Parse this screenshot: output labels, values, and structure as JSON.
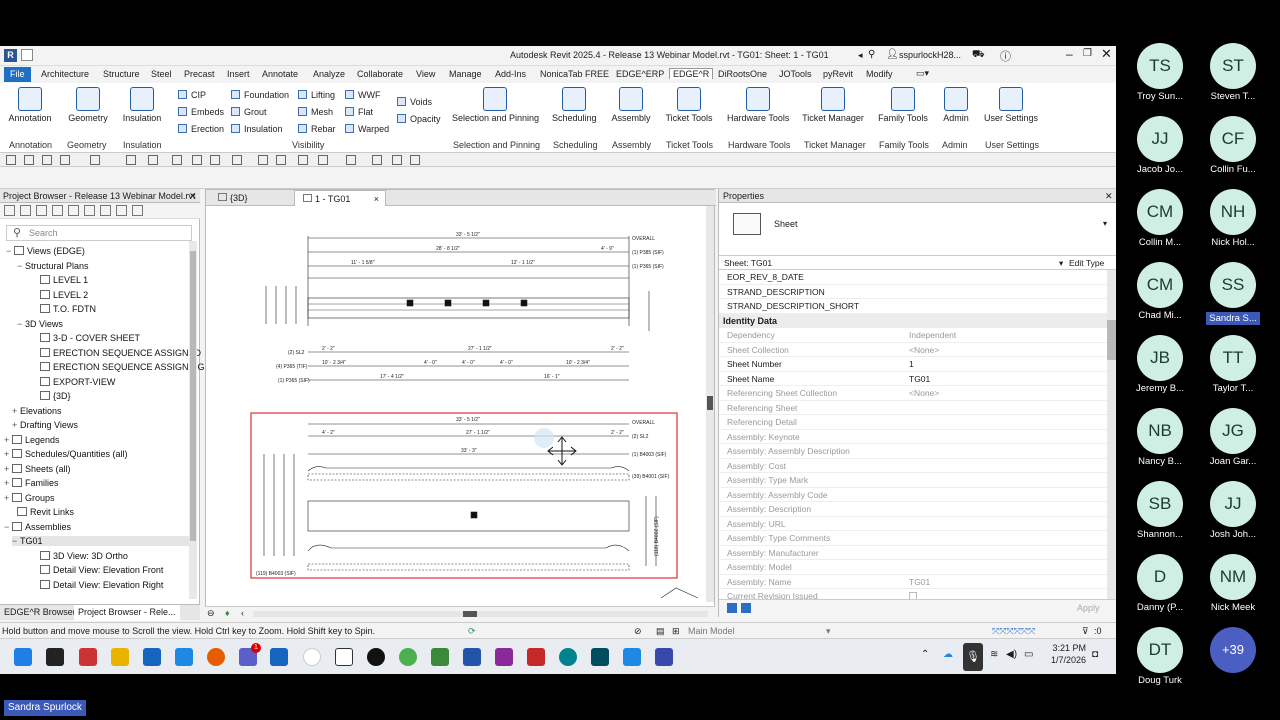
{
  "window": {
    "title": "Autodesk Revit 2025.4 - Release 13 Webinar Model.rvt - TG01: Sheet: 1 - TG01",
    "user": "sspurlockH28..."
  },
  "ribbon_tabs": [
    "File",
    "Architecture",
    "Structure",
    "Steel",
    "Precast",
    "Insert",
    "Annotate",
    "Analyze",
    "Collaborate",
    "View",
    "Manage",
    "Add-Ins",
    "NonicaTab FREE",
    "EDGE^ERP",
    "EDGE^R",
    "DiRootsOne",
    "JOTools",
    "pyRevit",
    "Modify"
  ],
  "ribbon": {
    "annotation": "Annotation",
    "geometry": "Geometry",
    "insulation": "Insulation",
    "cip": "CIP",
    "embeds": "Embeds",
    "erection": "Erection",
    "foundation": "Foundation",
    "grout": "Grout",
    "insulation_small": "Insulation",
    "lifting": "Lifting",
    "mesh": "Mesh",
    "rebar": "Rebar",
    "wwf": "WWF",
    "flat": "Flat",
    "warped": "Warped",
    "voids": "Voids",
    "opacity": "Opacity",
    "selection_pinning": "Selection and Pinning",
    "scheduling": "Scheduling",
    "assembly": "Assembly",
    "ticket_tools": "Ticket Tools",
    "hardware_tools": "Hardware Tools",
    "ticket_manager": "Ticket Manager",
    "family_tools": "Family Tools",
    "admin": "Admin",
    "user_settings": "User Settings",
    "panels": {
      "annotation": "Annotation",
      "geometry": "Geometry",
      "insulation": "Insulation",
      "visibility": "Visibility",
      "selection_pinning": "Selection and Pinning",
      "scheduling": "Scheduling",
      "assembly": "Assembly",
      "ticket_tools": "Ticket Tools",
      "hardware_tools": "Hardware Tools",
      "ticket_manager": "Ticket Manager",
      "family_tools": "Family Tools",
      "admin": "Admin",
      "user_settings": "User Settings"
    }
  },
  "project_browser": {
    "title": "Project Browser - Release 13 Webinar Model.rvt",
    "search_placeholder": "Search",
    "items": [
      {
        "label": "Views (EDGE)",
        "toggle": "−"
      },
      {
        "label": "Structural Plans",
        "toggle": "−"
      },
      {
        "label": "LEVEL 1",
        "toggle": ""
      },
      {
        "label": "LEVEL 2",
        "toggle": ""
      },
      {
        "label": "T.O. FDTN",
        "toggle": ""
      },
      {
        "label": "3D Views",
        "toggle": "−"
      },
      {
        "label": "3-D - COVER SHEET",
        "toggle": ""
      },
      {
        "label": "ERECTION SEQUENCE ASSIGNED",
        "toggle": ""
      },
      {
        "label": "ERECTION SEQUENCE ASSIGNING",
        "toggle": ""
      },
      {
        "label": "EXPORT-VIEW",
        "toggle": ""
      },
      {
        "label": "{3D}",
        "toggle": ""
      },
      {
        "label": "Elevations",
        "toggle": "+"
      },
      {
        "label": "Drafting Views",
        "toggle": "+"
      },
      {
        "label": "Legends",
        "toggle": "+"
      },
      {
        "label": "Schedules/Quantities (all)",
        "toggle": "+"
      },
      {
        "label": "Sheets (all)",
        "toggle": "+"
      },
      {
        "label": "Families",
        "toggle": "+"
      },
      {
        "label": "Groups",
        "toggle": "+"
      },
      {
        "label": "Revit Links",
        "toggle": ""
      },
      {
        "label": "Assemblies",
        "toggle": "−"
      },
      {
        "label": "TG01",
        "toggle": "−"
      },
      {
        "label": "3D View: 3D Ortho",
        "toggle": ""
      },
      {
        "label": "Detail View: Elevation Front",
        "toggle": ""
      },
      {
        "label": "Detail View: Elevation Right",
        "toggle": ""
      }
    ],
    "bottom_tabs": [
      "EDGE^R Browser",
      "Project Browser - Rele..."
    ]
  },
  "view_tabs": [
    {
      "label": "{3D}"
    },
    {
      "label": "1 - TG01",
      "close": "×"
    }
  ],
  "properties": {
    "title": "Properties",
    "type": "Sheet",
    "selector": "Sheet: TG01",
    "edit_type": "Edit Type",
    "top_rows": [
      "EOR_REV_8_DATE",
      "STRAND_DESCRIPTION",
      "STRAND_DESCRIPTION_SHORT"
    ],
    "group": "Identity Data",
    "rows": [
      {
        "name": "Dependency",
        "value": "Independent",
        "greyed": true
      },
      {
        "name": "Sheet Collection",
        "value": "<None>",
        "greyed": true
      },
      {
        "name": "Sheet Number",
        "value": "1",
        "greyed": false
      },
      {
        "name": "Sheet Name",
        "value": "TG01",
        "greyed": false
      },
      {
        "name": "Referencing Sheet Collection",
        "value": "<None>",
        "greyed": true
      },
      {
        "name": "Referencing Sheet",
        "value": "",
        "greyed": true
      },
      {
        "name": "Referencing Detail",
        "value": "",
        "greyed": true
      },
      {
        "name": "Assembly: Keynote",
        "value": "",
        "greyed": true
      },
      {
        "name": "Assembly: Assembly Description",
        "value": "",
        "greyed": true
      },
      {
        "name": "Assembly: Cost",
        "value": "",
        "greyed": true
      },
      {
        "name": "Assembly: Type Mark",
        "value": "",
        "greyed": true
      },
      {
        "name": "Assembly: Assembly Code",
        "value": "",
        "greyed": true
      },
      {
        "name": "Assembly: Description",
        "value": "",
        "greyed": true
      },
      {
        "name": "Assembly: URL",
        "value": "",
        "greyed": true
      },
      {
        "name": "Assembly: Type Comments",
        "value": "",
        "greyed": true
      },
      {
        "name": "Assembly: Manufacturer",
        "value": "",
        "greyed": true
      },
      {
        "name": "Assembly: Model",
        "value": "",
        "greyed": true
      },
      {
        "name": "Assembly: Name",
        "value": "TG01",
        "greyed": true
      },
      {
        "name": "Current Revision Issued",
        "value": "",
        "greyed": true
      }
    ],
    "apply": "Apply"
  },
  "status": {
    "hint": "Hold button and move mouse to Scroll the view. Hold Ctrl key to Zoom. Hold Shift key to Spin.",
    "model": "Main Model",
    "filter_count": ":0"
  },
  "taskbar": {
    "time": "3:21 PM",
    "date": "1/7/2026",
    "badge": "1"
  },
  "drawing": {
    "top": {
      "overall": "33' - 5 1/2\"",
      "d1": "28' - 8 1/2\"",
      "d2": "4' - 9\"",
      "d3": "11' - 1 5/8\"",
      "d4": "12' - 1 1/2\"",
      "lbl_overall": "OVERALL",
      "lbl_p385": "(1) P385 (SIF)",
      "lbl_p365": "(1) P365 (SIF)",
      "b1": "2' - 2\"",
      "b2": "27' - 1 1/2\"",
      "b3": "2' - 2\"",
      "c1": "10' - 2 3/4\"",
      "c2": "4' - 0\"",
      "c3": "4' - 0\"",
      "c4": "4' - 0\"",
      "c5": "10' - 2 3/4\"",
      "e1": "17' - 4 1/2\"",
      "e2": "16' - 1\"",
      "lbl_sl2": "(2) SL2",
      "lbl_p365b": "(4) P365 (TIF)",
      "lbl_p385b": "(1) P365 (SIF)"
    },
    "bottom": {
      "overall": "33' - 5 1/2\"",
      "d1": "4' - 2\"",
      "d2": "27' - 1 1/2\"",
      "d3": "2' - 2\"",
      "d4": "33' - 3\"",
      "lbl_overall": "OVERALL",
      "lbl_sl2": "(2) SL2",
      "lbl_b4003": "(1) B4003 (SIF)",
      "lbl_b4001": "(39) B4001 (SIF)",
      "lbl_b4002": "(118) B4002 (SIF)",
      "lbl_bottom": "(119) B4003 (SIF)"
    }
  },
  "participants": [
    {
      "initials": "TS",
      "name": "Troy Sun...",
      "highlight": false
    },
    {
      "initials": "ST",
      "name": "Steven T...",
      "highlight": false
    },
    {
      "initials": "JJ",
      "name": "Jacob Jo...",
      "highlight": false
    },
    {
      "initials": "CF",
      "name": "Collin Fu...",
      "highlight": false
    },
    {
      "initials": "CM",
      "name": "Collin M...",
      "highlight": false
    },
    {
      "initials": "NH",
      "name": "Nick Hol...",
      "highlight": false
    },
    {
      "initials": "CM",
      "name": "Chad Mi...",
      "highlight": false
    },
    {
      "initials": "SS",
      "name": "Sandra S...",
      "highlight": true
    },
    {
      "initials": "JB",
      "name": "Jeremy B...",
      "highlight": false
    },
    {
      "initials": "TT",
      "name": "Taylor T...",
      "highlight": false
    },
    {
      "initials": "NB",
      "name": "Nancy B...",
      "highlight": false
    },
    {
      "initials": "JG",
      "name": "Joan Gar...",
      "highlight": false
    },
    {
      "initials": "SB",
      "name": "Shannon...",
      "highlight": false
    },
    {
      "initials": "JJ",
      "name": "Josh Joh...",
      "highlight": false
    },
    {
      "initials": "D",
      "name": "Danny (P...",
      "highlight": false
    },
    {
      "initials": "NM",
      "name": "Nick Meek",
      "highlight": false
    },
    {
      "initials": "DT",
      "name": "Doug Turk",
      "highlight": false
    },
    {
      "initials": "+39",
      "name": "",
      "highlight": false
    }
  ],
  "presenter": "Sandra Spurlock",
  "colors": {
    "file_tab": "#1f6fc5",
    "selection_red": "#e0303a",
    "more_avatar": "#4a5fc1",
    "name_plate": "#3c59b8"
  }
}
